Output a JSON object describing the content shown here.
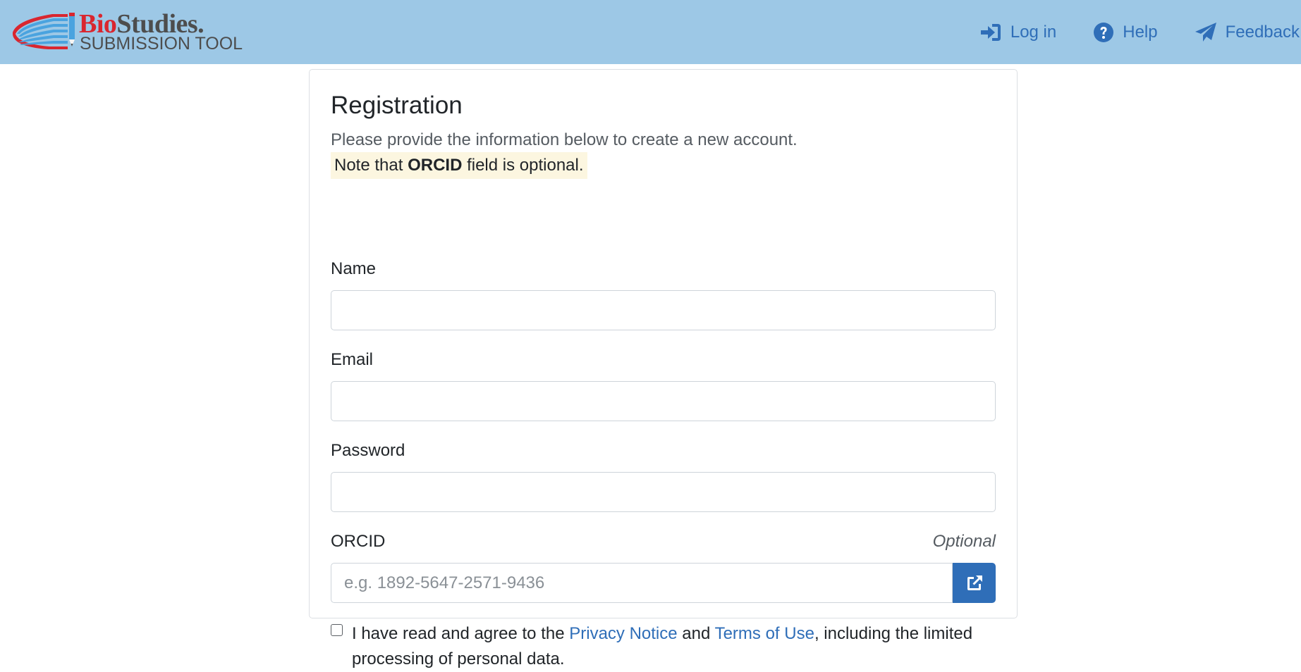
{
  "header": {
    "logo": {
      "title_part1": "Bio",
      "title_part2": "Studies.",
      "subtitle": "SUBMISSION TOOL"
    },
    "nav": [
      {
        "label": "Log in",
        "icon": "sign-in-icon"
      },
      {
        "label": "Help",
        "icon": "question-circle-icon"
      },
      {
        "label": "Feedback",
        "icon": "paper-plane-icon"
      }
    ],
    "colors": {
      "bar": "#9dc8e6",
      "link": "#2f6eb8",
      "logo_red": "#d9262f"
    }
  },
  "form": {
    "title": "Registration",
    "subtitle": "Please provide the information below to create a new account.",
    "note": {
      "before": "Note that ",
      "bold": "ORCID",
      "after": " field is optional."
    },
    "fields": {
      "name": {
        "label": "Name",
        "value": ""
      },
      "email": {
        "label": "Email",
        "value": ""
      },
      "password": {
        "label": "Password",
        "value": ""
      },
      "orcid": {
        "label": "ORCID",
        "optional_label": "Optional",
        "placeholder": "e.g. 1892-5647-2571-9436",
        "value": "",
        "button_icon": "external-link-icon"
      }
    },
    "agreement": {
      "checked": false,
      "text_before": "I have read and agree to the ",
      "privacy_link": "Privacy Notice",
      "text_middle": " and ",
      "terms_link": "Terms of Use",
      "text_after": ", including the limited processing of personal data."
    }
  }
}
